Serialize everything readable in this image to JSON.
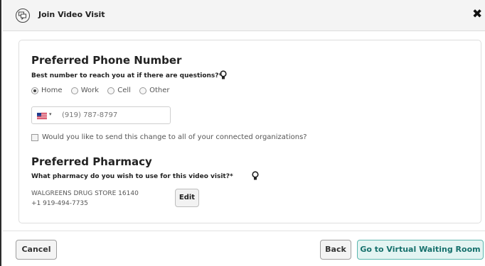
{
  "dialog": {
    "title": "Join Video Visit",
    "close_label": "✖",
    "title_icon": "video-chat-icon"
  },
  "phone_section": {
    "heading": "Preferred Phone Number",
    "question": "Best number to reach you at if there are questions?*",
    "hint_icon": "lightbulb-icon",
    "options": [
      {
        "label": "Home",
        "selected": true
      },
      {
        "label": "Work",
        "selected": false
      },
      {
        "label": "Cell",
        "selected": false
      },
      {
        "label": "Other",
        "selected": false
      }
    ],
    "country_flag": "us-flag-icon",
    "country_caret": "▾",
    "phone_value": "(919) 787-8797",
    "share_checkbox_label": "Would you like to send this change to all of your connected organizations?",
    "share_checked": false
  },
  "pharmacy_section": {
    "heading": "Preferred Pharmacy",
    "question": "What pharmacy do you wish to use for this video visit?*",
    "hint_icon": "lightbulb-icon",
    "pharmacy_name": "WALGREENS DRUG STORE 16140",
    "pharmacy_phone": "+1 919-494-7735",
    "edit_label": "Edit"
  },
  "footer": {
    "cancel_label": "Cancel",
    "back_label": "Back",
    "go_label": "Go to Virtual Waiting Room"
  },
  "colors": {
    "accent": "#16706c",
    "accent_border": "#5bb6ae",
    "accent_bg": "#e3f4f2"
  }
}
